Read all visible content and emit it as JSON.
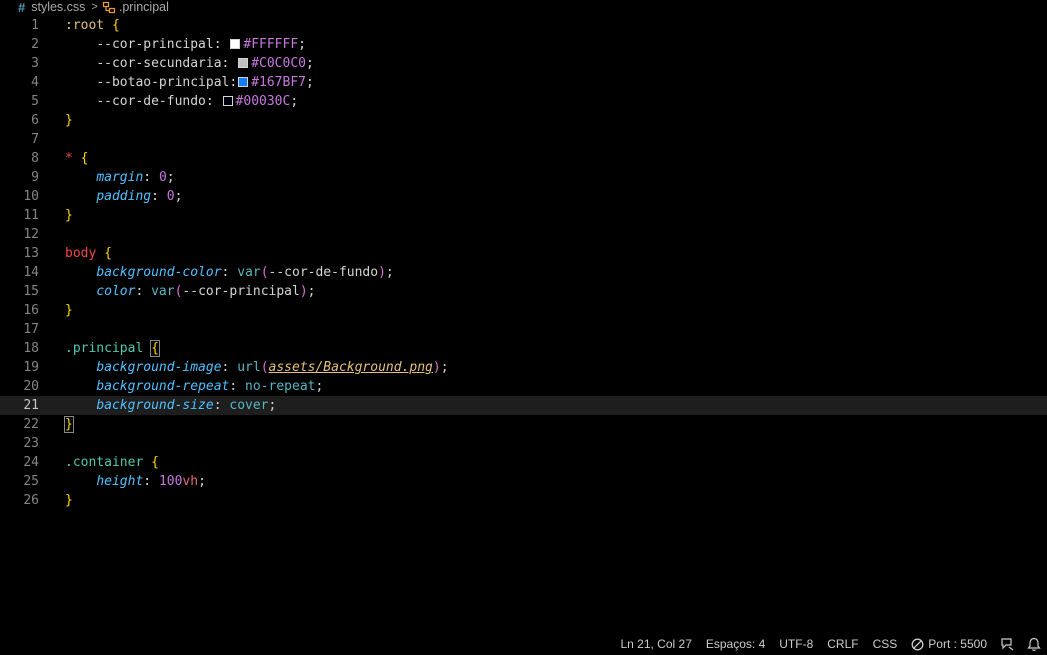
{
  "breadcrumb": {
    "file_icon": "#",
    "file": "styles.css",
    "separator": ">",
    "symbol": ".principal"
  },
  "editor": {
    "current_line": 21,
    "lines": [
      {
        "n": "1",
        "tokens": [
          {
            "c": "t-root",
            "t": ":root"
          },
          {
            "c": "t-punct",
            "t": " "
          },
          {
            "c": "t-brace",
            "t": "{"
          }
        ]
      },
      {
        "n": "2",
        "tokens": [
          {
            "c": "t-punct",
            "t": "    "
          },
          {
            "c": "t-var",
            "t": "--cor-principal"
          },
          {
            "c": "t-punct",
            "t": ": "
          },
          {
            "swatch": "#FFFFFF"
          },
          {
            "c": "t-hex",
            "t": "#FFFFFF"
          },
          {
            "c": "t-punct",
            "t": ";"
          }
        ]
      },
      {
        "n": "3",
        "tokens": [
          {
            "c": "t-punct",
            "t": "    "
          },
          {
            "c": "t-var",
            "t": "--cor-secundaria"
          },
          {
            "c": "t-punct",
            "t": ": "
          },
          {
            "swatch": "#C0C0C0"
          },
          {
            "c": "t-hex",
            "t": "#C0C0C0"
          },
          {
            "c": "t-punct",
            "t": ";"
          }
        ]
      },
      {
        "n": "4",
        "tokens": [
          {
            "c": "t-punct",
            "t": "    "
          },
          {
            "c": "t-var",
            "t": "--botao-principal"
          },
          {
            "c": "t-punct",
            "t": ":"
          },
          {
            "swatch": "#167BF7"
          },
          {
            "c": "t-hex",
            "t": "#167BF7"
          },
          {
            "c": "t-punct",
            "t": ";"
          }
        ]
      },
      {
        "n": "5",
        "tokens": [
          {
            "c": "t-punct",
            "t": "    "
          },
          {
            "c": "t-var",
            "t": "--cor-de-fundo"
          },
          {
            "c": "t-punct",
            "t": ": "
          },
          {
            "swatch": "#00030C"
          },
          {
            "c": "t-hex",
            "t": "#00030C"
          },
          {
            "c": "t-punct",
            "t": ";"
          }
        ]
      },
      {
        "n": "6",
        "tokens": [
          {
            "c": "t-brace",
            "t": "}"
          }
        ]
      },
      {
        "n": "7",
        "tokens": []
      },
      {
        "n": "8",
        "tokens": [
          {
            "c": "t-tag",
            "t": "*"
          },
          {
            "c": "t-punct",
            "t": " "
          },
          {
            "c": "t-brace",
            "t": "{"
          }
        ]
      },
      {
        "n": "9",
        "tokens": [
          {
            "c": "t-punct",
            "t": "    "
          },
          {
            "c": "t-prop",
            "t": "margin"
          },
          {
            "c": "t-punct",
            "t": ": "
          },
          {
            "c": "t-hex",
            "t": "0"
          },
          {
            "c": "t-punct",
            "t": ";"
          }
        ]
      },
      {
        "n": "10",
        "tokens": [
          {
            "c": "t-punct",
            "t": "    "
          },
          {
            "c": "t-prop",
            "t": "padding"
          },
          {
            "c": "t-punct",
            "t": ": "
          },
          {
            "c": "t-hex",
            "t": "0"
          },
          {
            "c": "t-punct",
            "t": ";"
          }
        ]
      },
      {
        "n": "11",
        "tokens": [
          {
            "c": "t-brace",
            "t": "}"
          }
        ]
      },
      {
        "n": "12",
        "tokens": []
      },
      {
        "n": "13",
        "tokens": [
          {
            "c": "t-tag",
            "t": "body"
          },
          {
            "c": "t-punct",
            "t": " "
          },
          {
            "c": "t-brace",
            "t": "{"
          }
        ]
      },
      {
        "n": "14",
        "tokens": [
          {
            "c": "t-punct",
            "t": "    "
          },
          {
            "c": "t-prop",
            "t": "background-color"
          },
          {
            "c": "t-punct",
            "t": ": "
          },
          {
            "c": "t-func",
            "t": "var"
          },
          {
            "c": "t-paren",
            "t": "("
          },
          {
            "c": "t-var",
            "t": "--cor-de-fundo"
          },
          {
            "c": "t-paren",
            "t": ")"
          },
          {
            "c": "t-punct",
            "t": ";"
          }
        ]
      },
      {
        "n": "15",
        "tokens": [
          {
            "c": "t-punct",
            "t": "    "
          },
          {
            "c": "t-prop",
            "t": "color"
          },
          {
            "c": "t-punct",
            "t": ": "
          },
          {
            "c": "t-func",
            "t": "var"
          },
          {
            "c": "t-paren",
            "t": "("
          },
          {
            "c": "t-var",
            "t": "--cor-principal"
          },
          {
            "c": "t-paren",
            "t": ")"
          },
          {
            "c": "t-punct",
            "t": ";"
          }
        ]
      },
      {
        "n": "16",
        "tokens": [
          {
            "c": "t-brace",
            "t": "}"
          }
        ]
      },
      {
        "n": "17",
        "tokens": []
      },
      {
        "n": "18",
        "tokens": [
          {
            "c": "t-cls",
            "t": ".principal"
          },
          {
            "c": "t-punct",
            "t": " "
          },
          {
            "c": "t-brace bracket-match",
            "t": "{"
          }
        ]
      },
      {
        "n": "19",
        "tokens": [
          {
            "c": "t-punct",
            "t": "    "
          },
          {
            "c": "t-prop",
            "t": "background-image"
          },
          {
            "c": "t-punct",
            "t": ": "
          },
          {
            "c": "t-func",
            "t": "url"
          },
          {
            "c": "t-paren",
            "t": "("
          },
          {
            "c": "t-str",
            "t": "assets/Background.png"
          },
          {
            "c": "t-paren",
            "t": ")"
          },
          {
            "c": "t-punct",
            "t": ";"
          }
        ]
      },
      {
        "n": "20",
        "tokens": [
          {
            "c": "t-punct",
            "t": "    "
          },
          {
            "c": "t-prop",
            "t": "background-repeat"
          },
          {
            "c": "t-punct",
            "t": ": "
          },
          {
            "c": "t-kw",
            "t": "no-repeat"
          },
          {
            "c": "t-punct",
            "t": ";"
          }
        ]
      },
      {
        "n": "21",
        "tokens": [
          {
            "c": "t-punct",
            "t": "    "
          },
          {
            "c": "t-prop",
            "t": "background-size"
          },
          {
            "c": "t-punct",
            "t": ": "
          },
          {
            "c": "t-kw",
            "t": "cover"
          },
          {
            "c": "t-punct",
            "t": ";"
          }
        ]
      },
      {
        "n": "22",
        "tokens": [
          {
            "c": "t-brace bracket-match",
            "t": "}"
          }
        ]
      },
      {
        "n": "23",
        "tokens": []
      },
      {
        "n": "24",
        "tokens": [
          {
            "c": "t-cls",
            "t": ".container"
          },
          {
            "c": "t-punct",
            "t": " "
          },
          {
            "c": "t-brace",
            "t": "{"
          }
        ]
      },
      {
        "n": "25",
        "tokens": [
          {
            "c": "t-punct",
            "t": "    "
          },
          {
            "c": "t-prop",
            "t": "height"
          },
          {
            "c": "t-punct",
            "t": ": "
          },
          {
            "c": "t-hex",
            "t": "100"
          },
          {
            "c": "t-unit",
            "t": "vh"
          },
          {
            "c": "t-punct",
            "t": ";"
          }
        ]
      },
      {
        "n": "26",
        "tokens": [
          {
            "c": "t-brace",
            "t": "}"
          }
        ]
      }
    ]
  },
  "statusbar": {
    "position": "Ln 21, Col 27",
    "indent": "Espaços: 4",
    "encoding": "UTF-8",
    "eol": "CRLF",
    "language": "CSS",
    "port": "Port : 5500",
    "port_icon": "no-entry-icon",
    "feedback_icon": "feedback-icon",
    "bell_icon": "bell-icon"
  }
}
